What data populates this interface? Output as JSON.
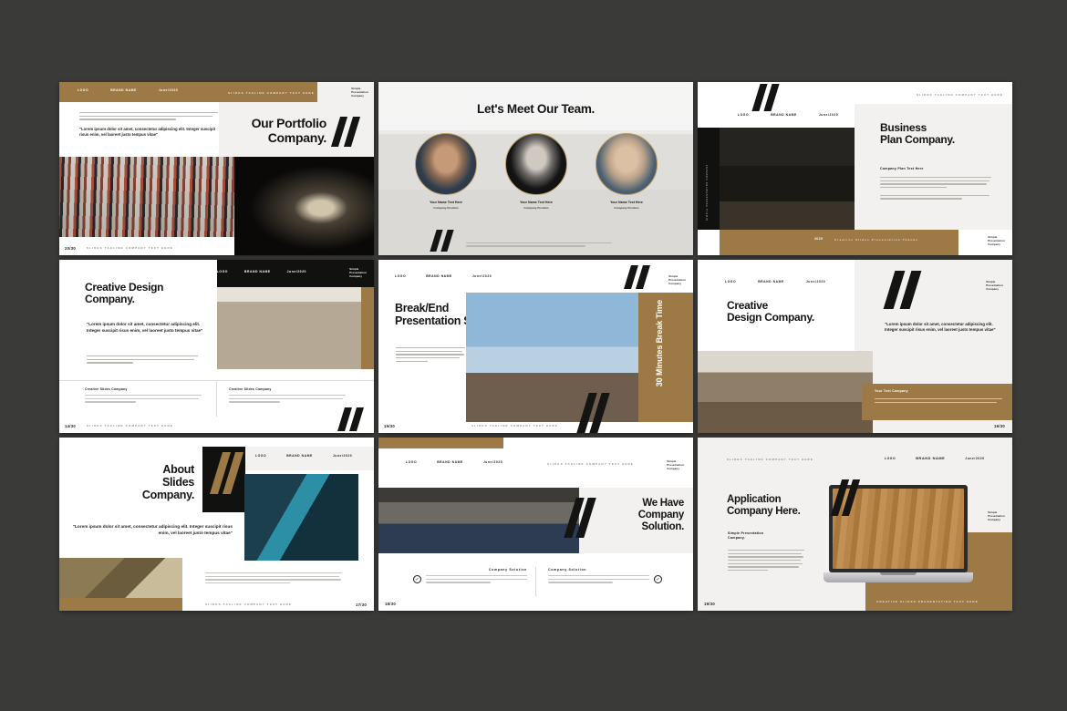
{
  "meta": {
    "background_color": "#3a3a38",
    "accent_gold": "#9d7a45",
    "dark": "#111110",
    "offwhite": "#f2f1ef"
  },
  "common": {
    "nav": {
      "logo": "LOGO",
      "brand": "BRAND NAME",
      "date": "June/2020"
    },
    "tagline": "SLIDES TAGLINE COMPANY TEXT HERE",
    "brand_block": "Simple\nPresentation\nCompany",
    "brand_block_l1": "Simple",
    "brand_block_l2": "Presentation",
    "brand_block_l3": "Company"
  },
  "slides": [
    {
      "id": "our-portfolio",
      "title_l1": "Our Portfolio",
      "title_l2": "Company.",
      "quote": "\"Lorem ipsum dolor sit amet, consectetur adipiscing elit. Integer suscipit risus enim, vel laoreet justo tempus vitae\"",
      "page": "20/30",
      "footer_tagline": "SLIDES TAGLINE COMPANY TEXT HERE"
    },
    {
      "id": "meet-our-team",
      "title": "Let's Meet Our Team.",
      "members": [
        {
          "name": "Your Name Text Here",
          "role": "Company Position"
        },
        {
          "name": "Your Name Text Here",
          "role": "Company Position"
        },
        {
          "name": "Your Name Text Here",
          "role": "Company Position"
        }
      ]
    },
    {
      "id": "business-plan",
      "title_l1": "Business",
      "title_l2": "Plan Company.",
      "subhead": "Company Plan Text Here",
      "page": "2020",
      "footer_tagline": "Creative Slides Presentation Thanks",
      "sidebar_vertical": "SIMPLE PRESENTATION COMPANY"
    },
    {
      "id": "creative-design-1",
      "title_l1": "Creative Design",
      "title_l2": "Company.",
      "quote": "\"Lorem ipsum dolor sit amet, consectetur adipiscing elit. Integer suscipit risus enim, vel laoreet justo tempus vitae\"",
      "col1_head": "Creative Slides Company",
      "col2_head": "Creative Slides Company",
      "page": "14/30",
      "footer_tagline": "SLIDES TAGLINE COMPANY TEXT HERE"
    },
    {
      "id": "break-end",
      "title_l1": "Break/End",
      "title_l2": "Presentation Slide",
      "vertical_text": "30 Minutes Break Time",
      "page": "15/30",
      "footer_tagline": "SLIDES TAGLINE COMPANY TEXT HERE"
    },
    {
      "id": "creative-design-2",
      "title_l1": "Creative",
      "title_l2": "Design Company.",
      "quote": "\"Lorem ipsum dolor sit amet, consectetur adipiscing elit. Integer suscipit risus enim, vel laoreet justo tempus vitae\"",
      "card_head": "Your Text Company",
      "page": "16/30"
    },
    {
      "id": "about-slides",
      "title_l1": "About",
      "title_l2": "Slides",
      "title_l3": "Company.",
      "quote": "\"Lorem ipsum dolor sit amet, consectetur adipiscing elit. Integer suscipit risus enim, vel laoreet justo tempus vitae\"",
      "page": "17/30",
      "footer_tagline": "SLIDES TAGLINE COMPANY TEXT HERE"
    },
    {
      "id": "company-solution",
      "title_l1": "We Have",
      "title_l2": "Company",
      "title_l3": "Solution.",
      "col1_head": "Company Solution",
      "col2_head": "Company Solution",
      "page": "18/30",
      "tagline": "SLIDES TAGLINE COMPANY TEXT HERE"
    },
    {
      "id": "application-company",
      "title_l1": "Application",
      "title_l2": "Company Here.",
      "subhead_l1": "Simple Presentation",
      "subhead_l2": "Company.",
      "page": "19/30",
      "tagline": "SLIDES TAGLINE COMPANY TEXT HERE",
      "footer_tagline": "CREATIVE SLIDES PRESENTATION TEXT HERE"
    }
  ]
}
